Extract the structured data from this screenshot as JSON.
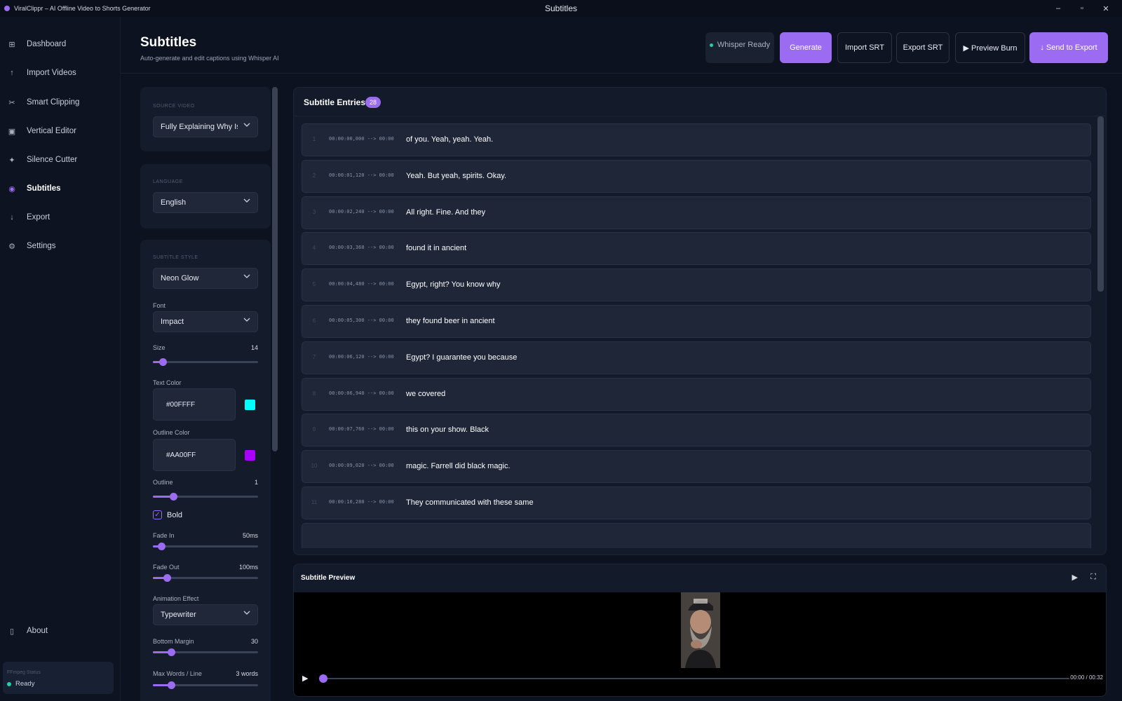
{
  "window": {
    "app_title": "ViralClippr – AI Offline Video to Shorts Generator",
    "center_title": "Subtitles",
    "minimize": "–",
    "maximize": "▫",
    "close": "✕"
  },
  "sidebar": {
    "items": [
      {
        "label": "Dashboard",
        "icon": "grid-icon"
      },
      {
        "label": "Import Videos",
        "icon": "upload-icon"
      },
      {
        "label": "Smart Clipping",
        "icon": "scissors-icon"
      },
      {
        "label": "Vertical Editor",
        "icon": "frame-icon"
      },
      {
        "label": "Silence Cutter",
        "icon": "sparkle-icon"
      },
      {
        "label": "Subtitles",
        "icon": "dot-icon",
        "active": true
      },
      {
        "label": "Export",
        "icon": "download-icon"
      },
      {
        "label": "Settings",
        "icon": "gear-icon"
      }
    ],
    "about": "About",
    "ffmpeg_label": "FFmpeg Status",
    "ffmpeg_status": "Ready"
  },
  "header": {
    "title": "Subtitles",
    "subtitle": "Auto-generate and edit captions using Whisper AI",
    "whisper_status": "Whisper Ready",
    "generate": "Generate",
    "import_srt": "Import SRT",
    "export_srt": "Export SRT",
    "preview_burn": "▶ Preview Burn",
    "send_to_export": "↓ Send to Export"
  },
  "settings": {
    "source_label": "SOURCE VIDEO",
    "source_value": "Fully Explaining Why Is",
    "language_label": "LANGUAGE",
    "language_value": "English",
    "style_label": "SUBTITLE STYLE",
    "style_value": "Neon Glow",
    "font_label": "Font",
    "font_value": "Impact",
    "size_label": "Size",
    "size_value": "14",
    "size_fraction": 0.09,
    "text_color_label": "Text Color",
    "text_color": "#00FFFF",
    "outline_color_label": "Outline Color",
    "outline_color": "#AA00FF",
    "outline_label": "Outline",
    "outline_value": "1",
    "outline_fraction": 0.19,
    "bold_label": "Bold",
    "bold_checked": true,
    "fade_in_label": "Fade In",
    "fade_in_value": "50ms",
    "fade_in_fraction": 0.08,
    "fade_out_label": "Fade Out",
    "fade_out_value": "100ms",
    "fade_out_fraction": 0.13,
    "animation_label": "Animation Effect",
    "animation_value": "Typewriter",
    "margin_label": "Bottom Margin",
    "margin_value": "30",
    "margin_fraction": 0.17,
    "max_words_label": "Max Words / Line",
    "max_words_value": "3 words",
    "max_words_fraction": 0.17
  },
  "entries": {
    "title": "Subtitle Entries",
    "count": "28",
    "rows": [
      {
        "num": "1",
        "time": "00:00:00,000 --> 00:00",
        "text": "of you. Yeah, yeah. Yeah."
      },
      {
        "num": "2",
        "time": "00:00:01,120 --> 00:00",
        "text": "Yeah. But yeah, spirits. Okay."
      },
      {
        "num": "3",
        "time": "00:00:02,240 --> 00:00",
        "text": "All right. Fine. And they"
      },
      {
        "num": "4",
        "time": "00:00:03,360 --> 00:00",
        "text": "found it in ancient"
      },
      {
        "num": "5",
        "time": "00:00:04,480 --> 00:00",
        "text": "Egypt, right? You know why"
      },
      {
        "num": "6",
        "time": "00:00:05,300 --> 00:00",
        "text": "they found beer in ancient"
      },
      {
        "num": "7",
        "time": "00:00:06,120 --> 00:00",
        "text": "Egypt? I guarantee you because"
      },
      {
        "num": "8",
        "time": "00:00:06,940 --> 00:00",
        "text": "we covered"
      },
      {
        "num": "9",
        "time": "00:00:07,760 --> 00:00",
        "text": "this on your show. Black"
      },
      {
        "num": "10",
        "time": "00:00:09,020 --> 00:00",
        "text": "magic. Farrell did black magic."
      },
      {
        "num": "11",
        "time": "00:00:10,280 --> 00:00",
        "text": "They communicated with these same"
      },
      {
        "num": "",
        "time": "",
        "text": ""
      }
    ]
  },
  "preview": {
    "title": "Subtitle Preview",
    "play": "▶",
    "fullscreen": "⛶",
    "time": "00:00 / 00:32",
    "progress": 0.0
  }
}
